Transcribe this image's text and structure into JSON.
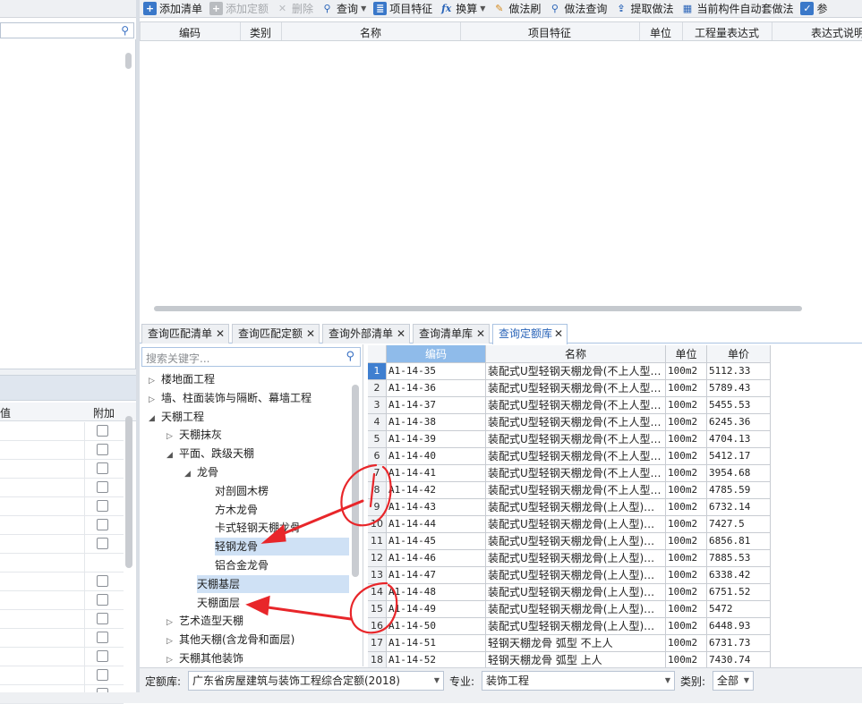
{
  "toolbar": {
    "items": [
      {
        "label": "添加清单",
        "icon": "add-list-icon",
        "disabled": false
      },
      {
        "label": "添加定额",
        "icon": "add-quota-icon",
        "disabled": true
      },
      {
        "label": "删除",
        "icon": "delete-icon",
        "disabled": true
      },
      {
        "label": "查询",
        "icon": "query-icon",
        "disabled": false,
        "dropdown": true
      },
      {
        "label": "项目特征",
        "icon": "feature-icon",
        "disabled": false
      },
      {
        "label": "换算",
        "icon": "fx-icon",
        "disabled": false,
        "dropdown": true
      },
      {
        "label": "做法刷",
        "icon": "brush-icon",
        "disabled": false
      },
      {
        "label": "做法查询",
        "icon": "method-query-icon",
        "disabled": false
      },
      {
        "label": "提取做法",
        "icon": "extract-icon",
        "disabled": false
      },
      {
        "label": "当前构件自动套做法",
        "icon": "auto-apply-icon",
        "disabled": false
      },
      {
        "label": "参",
        "icon": "checkbox-checked-icon",
        "disabled": false
      }
    ]
  },
  "main_grid": {
    "headers": [
      "编码",
      "类别",
      "名称",
      "项目特征",
      "单位",
      "工程量表达式",
      "表达式说明"
    ]
  },
  "left_panel": {
    "lower_headers": [
      "值",
      "附加"
    ]
  },
  "tabs": [
    {
      "label": "查询匹配清单",
      "active": false
    },
    {
      "label": "查询匹配定额",
      "active": false
    },
    {
      "label": "查询外部清单",
      "active": false
    },
    {
      "label": "查询清单库",
      "active": false
    },
    {
      "label": "查询定额库",
      "active": true
    }
  ],
  "tree": {
    "search_placeholder": "搜索关键字...",
    "nodes": [
      {
        "label": "楼地面工程",
        "level": 0,
        "state": "collapsed",
        "selected": false
      },
      {
        "label": "墙、柱面装饰与隔断、幕墙工程",
        "level": 0,
        "state": "collapsed",
        "selected": false
      },
      {
        "label": "天棚工程",
        "level": 0,
        "state": "expanded",
        "selected": false
      },
      {
        "label": "天棚抹灰",
        "level": 1,
        "state": "collapsed",
        "selected": false
      },
      {
        "label": "平面、跌级天棚",
        "level": 1,
        "state": "expanded",
        "selected": false
      },
      {
        "label": "龙骨",
        "level": 2,
        "state": "expanded",
        "selected": false
      },
      {
        "label": "对剖圆木楞",
        "level": 3,
        "state": "leaf",
        "selected": false
      },
      {
        "label": "方木龙骨",
        "level": 3,
        "state": "leaf",
        "selected": false
      },
      {
        "label": "卡式轻钢天棚龙骨",
        "level": 3,
        "state": "leaf",
        "selected": false
      },
      {
        "label": "轻钢龙骨",
        "level": 3,
        "state": "leaf",
        "selected": true
      },
      {
        "label": "铝合金龙骨",
        "level": 3,
        "state": "leaf",
        "selected": false
      },
      {
        "label": "天棚基层",
        "level": 2,
        "state": "leaf",
        "selected": true
      },
      {
        "label": "天棚面层",
        "level": 2,
        "state": "leaf",
        "selected": false
      },
      {
        "label": "艺术造型天棚",
        "level": 1,
        "state": "collapsed",
        "selected": false
      },
      {
        "label": "其他天棚(含龙骨和面层)",
        "level": 1,
        "state": "collapsed",
        "selected": false
      },
      {
        "label": "天棚其他装饰",
        "level": 1,
        "state": "collapsed",
        "selected": false
      }
    ]
  },
  "quota_table": {
    "headers": {
      "code": "编码",
      "name": "名称",
      "unit": "单位",
      "price": "单价"
    },
    "rows": [
      {
        "n": "1",
        "code": "A1-14-35",
        "name": "装配式U型轻钢天棚龙骨(不上人型…",
        "unit": "100m2",
        "price": "5112.33"
      },
      {
        "n": "2",
        "code": "A1-14-36",
        "name": "装配式U型轻钢天棚龙骨(不上人型…",
        "unit": "100m2",
        "price": "5789.43"
      },
      {
        "n": "3",
        "code": "A1-14-37",
        "name": "装配式U型轻钢天棚龙骨(不上人型…",
        "unit": "100m2",
        "price": "5455.53"
      },
      {
        "n": "4",
        "code": "A1-14-38",
        "name": "装配式U型轻钢天棚龙骨(不上人型…",
        "unit": "100m2",
        "price": "6245.36"
      },
      {
        "n": "5",
        "code": "A1-14-39",
        "name": "装配式U型轻钢天棚龙骨(不上人型…",
        "unit": "100m2",
        "price": "4704.13"
      },
      {
        "n": "6",
        "code": "A1-14-40",
        "name": "装配式U型轻钢天棚龙骨(不上人型…",
        "unit": "100m2",
        "price": "5412.17"
      },
      {
        "n": "7",
        "code": "A1-14-41",
        "name": "装配式U型轻钢天棚龙骨(不上人型…",
        "unit": "100m2",
        "price": "3954.68"
      },
      {
        "n": "8",
        "code": "A1-14-42",
        "name": "装配式U型轻钢天棚龙骨(不上人型…",
        "unit": "100m2",
        "price": "4785.59"
      },
      {
        "n": "9",
        "code": "A1-14-43",
        "name": "装配式U型轻钢天棚龙骨(上人型)…",
        "unit": "100m2",
        "price": "6732.14"
      },
      {
        "n": "10",
        "code": "A1-14-44",
        "name": "装配式U型轻钢天棚龙骨(上人型)…",
        "unit": "100m2",
        "price": "7427.5"
      },
      {
        "n": "11",
        "code": "A1-14-45",
        "name": "装配式U型轻钢天棚龙骨(上人型)…",
        "unit": "100m2",
        "price": "6856.81"
      },
      {
        "n": "12",
        "code": "A1-14-46",
        "name": "装配式U型轻钢天棚龙骨(上人型)…",
        "unit": "100m2",
        "price": "7885.53"
      },
      {
        "n": "13",
        "code": "A1-14-47",
        "name": "装配式U型轻钢天棚龙骨(上人型)…",
        "unit": "100m2",
        "price": "6338.42"
      },
      {
        "n": "14",
        "code": "A1-14-48",
        "name": "装配式U型轻钢天棚龙骨(上人型)…",
        "unit": "100m2",
        "price": "6751.52"
      },
      {
        "n": "15",
        "code": "A1-14-49",
        "name": "装配式U型轻钢天棚龙骨(上人型)…",
        "unit": "100m2",
        "price": "5472"
      },
      {
        "n": "16",
        "code": "A1-14-50",
        "name": "装配式U型轻钢天棚龙骨(上人型)…",
        "unit": "100m2",
        "price": "6448.93"
      },
      {
        "n": "17",
        "code": "A1-14-51",
        "name": "轻钢天棚龙骨 弧型 不上人",
        "unit": "100m2",
        "price": "6731.73"
      },
      {
        "n": "18",
        "code": "A1-14-52",
        "name": "轻钢天棚龙骨 弧型 上人",
        "unit": "100m2",
        "price": "7430.74"
      }
    ]
  },
  "bottom_bar": {
    "library_label": "定额库:",
    "library_value": "广东省房屋建筑与装饰工程综合定额(2018)",
    "major_label": "专业:",
    "major_value": "装饰工程",
    "category_label": "类别:",
    "category_value": "全部"
  },
  "colors": {
    "accent": "#2a64b8",
    "header_selected": "#8fbbea",
    "tree_selected": "#cfe1f5",
    "annotation": "#e8262a"
  }
}
